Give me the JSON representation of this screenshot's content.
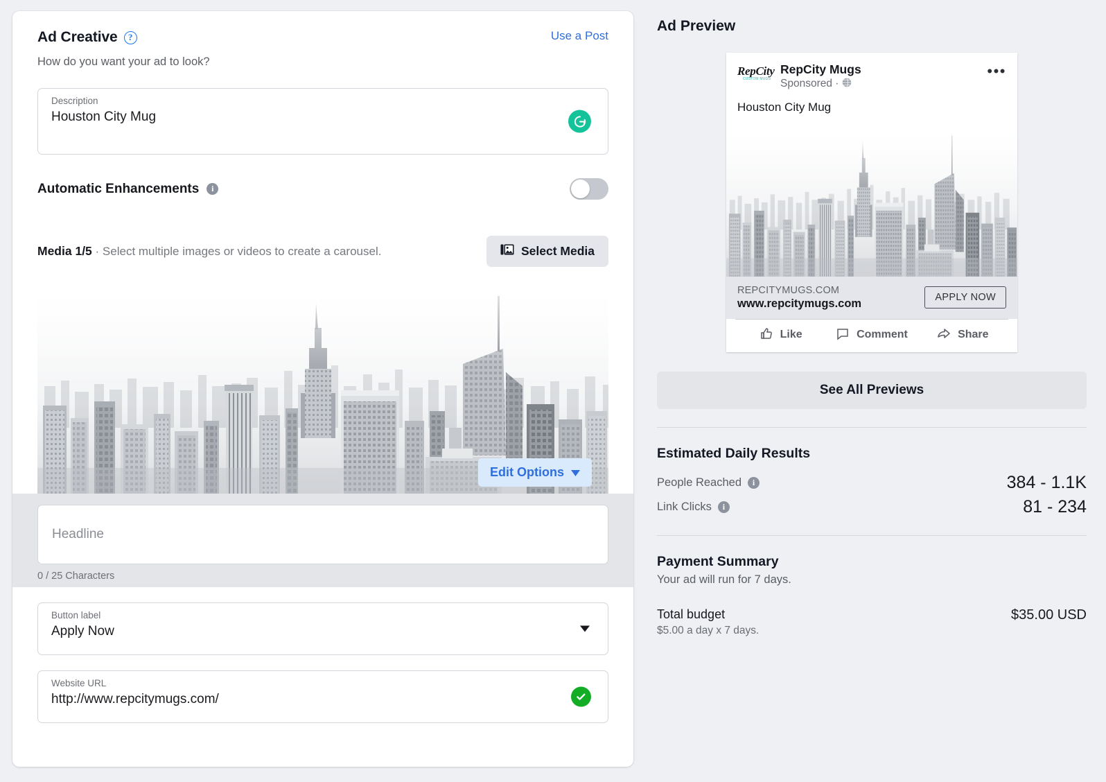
{
  "left": {
    "section_title": "Ad Creative",
    "help_icon": "question-circle-icon",
    "use_post_link": "Use a Post",
    "subtitle": "How do you want your ad to look?",
    "description_field": {
      "label": "Description",
      "value": "Houston City Mug",
      "assistant_icon": "grammarly-icon"
    },
    "automatic_enhancements": {
      "label": "Automatic Enhancements",
      "info_icon": "info-icon",
      "toggle_state": "off"
    },
    "media": {
      "counter": "Media 1/5",
      "hint": "· Select multiple images or videos to create a carousel.",
      "select_button": "Select Media",
      "select_button_icon": "photos-stack-icon",
      "edit_options": "Edit Options",
      "edit_options_icon": "chevron-down-icon"
    },
    "headline_field": {
      "placeholder": "Headline",
      "counter": "0 / 25 Characters"
    },
    "button_label_field": {
      "label": "Button label",
      "value": "Apply Now",
      "icon": "chevron-down-icon"
    },
    "website_url_field": {
      "label": "Website URL",
      "value": "http://www.repcitymugs.com/",
      "icon": "check-circle-icon"
    }
  },
  "right": {
    "panel_title": "Ad Preview",
    "post": {
      "logo_main": "RepCity",
      "logo_sub": "CUSTOM MUGS",
      "brand": "RepCity Mugs",
      "sponsored": "Sponsored ·",
      "globe_icon": "globe-icon",
      "menu_icon": "more-options-icon",
      "body_text": "Houston City Mug",
      "domain": "REPCITYMUGS.COM",
      "url": "www.repcitymugs.com",
      "cta": "APPLY NOW",
      "actions": [
        {
          "label": "Like",
          "icon": "thumbs-up-icon"
        },
        {
          "label": "Comment",
          "icon": "comment-bubble-icon"
        },
        {
          "label": "Share",
          "icon": "share-arrow-icon"
        }
      ]
    },
    "see_all_previews": "See All Previews",
    "estimated": {
      "title": "Estimated Daily Results",
      "rows": [
        {
          "label": "People Reached",
          "icon": "info-icon",
          "value": "384 - 1.1K"
        },
        {
          "label": "Link Clicks",
          "icon": "info-icon",
          "value": "81 - 234"
        }
      ]
    },
    "payment": {
      "title": "Payment Summary",
      "subtitle": "Your ad will run for 7 days.",
      "budget_label": "Total budget",
      "budget_note": "$5.00 a day x 7 days.",
      "budget_amount": "$35.00 USD"
    }
  },
  "colors": {
    "accent_blue": "#2f6fdd",
    "grammarly_green": "#15c39a",
    "valid_green": "#13ad25",
    "page_bg": "#eef0f4"
  }
}
